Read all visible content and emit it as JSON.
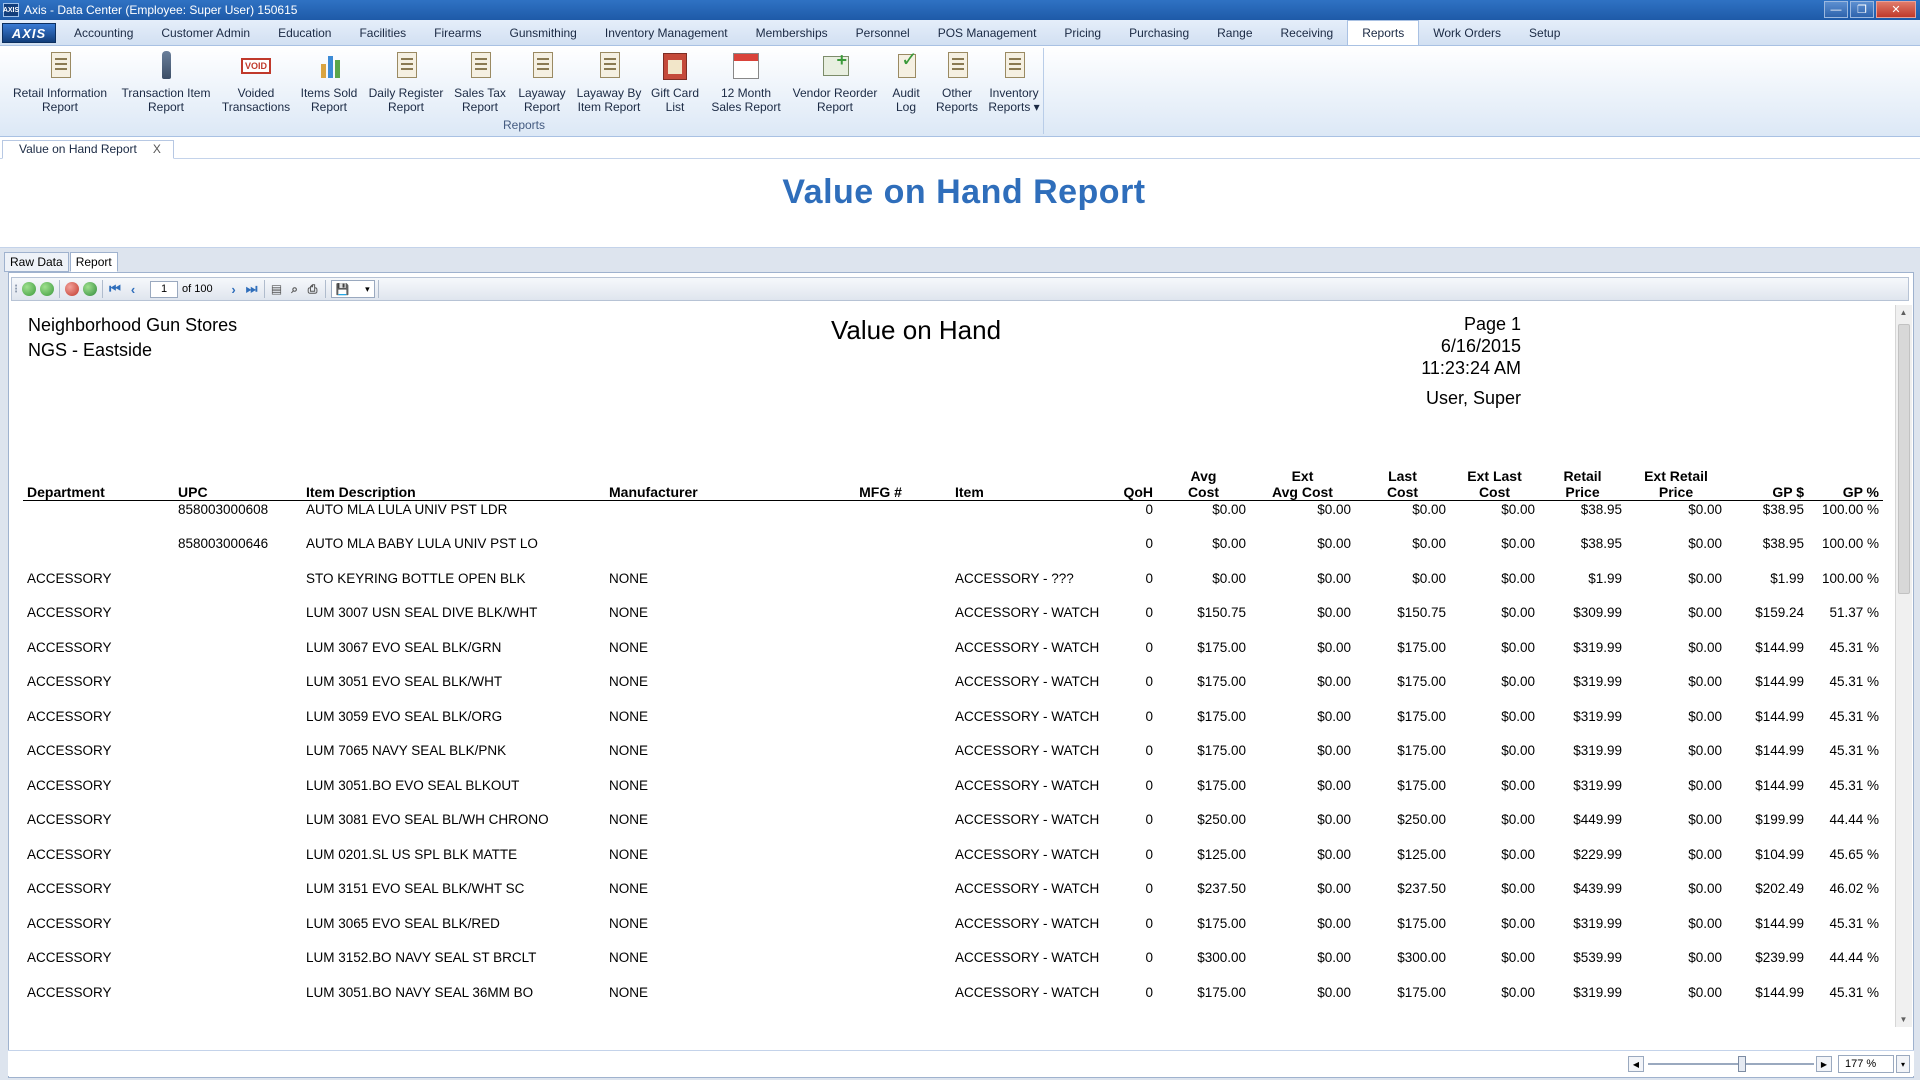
{
  "window": {
    "logo_label": "AXIS",
    "title": "Axis - Data Center  (Employee: Super User) 150615",
    "minimize": "—",
    "restore": "❐",
    "close": "✕"
  },
  "menu": {
    "logo": "AXIS",
    "tabs": [
      "Accounting",
      "Customer Admin",
      "Education",
      "Facilities",
      "Firearms",
      "Gunsmithing",
      "Inventory Management",
      "Memberships",
      "Personnel",
      "POS Management",
      "Pricing",
      "Purchasing",
      "Range",
      "Receiving",
      "Reports",
      "Work Orders",
      "Setup"
    ],
    "active": "Reports"
  },
  "ribbon": {
    "group_label": "Reports",
    "buttons": [
      {
        "line1": "Retail Information",
        "line2": "Report",
        "icon": "document-icon"
      },
      {
        "line1": "Transaction Item",
        "line2": "Report",
        "icon": "pen-icon"
      },
      {
        "line1": "Voided",
        "line2": "Transactions",
        "icon": "void-stamp-icon",
        "icon_text": "VOID"
      },
      {
        "line1": "Items Sold",
        "line2": "Report",
        "icon": "bar-chart-icon"
      },
      {
        "line1": "Daily Register",
        "line2": "Report",
        "icon": "document-icon"
      },
      {
        "line1": "Sales Tax",
        "line2": "Report",
        "icon": "document-icon"
      },
      {
        "line1": "Layaway",
        "line2": "Report",
        "icon": "document-icon"
      },
      {
        "line1": "Layaway By",
        "line2": "Item Report",
        "icon": "document-icon"
      },
      {
        "line1": "Gift Card",
        "line2": "List",
        "icon": "gift-card-icon"
      },
      {
        "line1": "12 Month",
        "line2": "Sales Report",
        "icon": "calendar-icon"
      },
      {
        "line1": "Vendor Reorder",
        "line2": "Report",
        "icon": "reorder-icon"
      },
      {
        "line1": "Audit",
        "line2": "Log",
        "icon": "checklist-icon"
      },
      {
        "line1": "Other",
        "line2": "Reports",
        "icon": "document-icon"
      },
      {
        "line1": "Inventory",
        "line2": "Reports ▾",
        "icon": "document-icon"
      }
    ]
  },
  "doc_tab": {
    "label": "Value on Hand Report",
    "close": "X"
  },
  "report_title": "Value on Hand Report",
  "subtabs": [
    "Raw Data",
    "Report"
  ],
  "toolbar": {
    "page": "1",
    "of": "of 100"
  },
  "report": {
    "company": "Neighborhood Gun Stores",
    "store": "NGS - Eastside",
    "name": "Value on Hand",
    "page": "Page 1",
    "date": "6/16/2015",
    "time": "11:23:24 AM",
    "user": "User, Super"
  },
  "columns": [
    {
      "l1": "",
      "l2": "Department"
    },
    {
      "l1": "",
      "l2": "UPC"
    },
    {
      "l1": "",
      "l2": "Item Description"
    },
    {
      "l1": "",
      "l2": "Manufacturer"
    },
    {
      "l1": "",
      "l2": "MFG #"
    },
    {
      "l1": "",
      "l2": "Item"
    },
    {
      "l1": "",
      "l2": "QoH"
    },
    {
      "l1": "Avg",
      "l2": "Cost"
    },
    {
      "l1": "Ext",
      "l2": "Avg Cost"
    },
    {
      "l1": "Last",
      "l2": "Cost"
    },
    {
      "l1": "Ext Last",
      "l2": "Cost"
    },
    {
      "l1": "Retail",
      "l2": "Price"
    },
    {
      "l1": "Ext Retail",
      "l2": "Price"
    },
    {
      "l1": "",
      "l2": "GP $"
    },
    {
      "l1": "",
      "l2": "GP %"
    }
  ],
  "rows": [
    [
      "",
      "858003000608",
      "AUTO MLA LULA UNIV PST LDR",
      "",
      "",
      "",
      "0",
      "$0.00",
      "$0.00",
      "$0.00",
      "$0.00",
      "$38.95",
      "$0.00",
      "$38.95",
      "100.00 %"
    ],
    [
      "",
      "858003000646",
      "AUTO MLA BABY LULA UNIV PST LO",
      "",
      "",
      "",
      "0",
      "$0.00",
      "$0.00",
      "$0.00",
      "$0.00",
      "$38.95",
      "$0.00",
      "$38.95",
      "100.00 %"
    ],
    [
      "ACCESSORY",
      "",
      "STO KEYRING BOTTLE OPEN BLK",
      "NONE",
      "",
      "ACCESSORY - ???",
      "0",
      "$0.00",
      "$0.00",
      "$0.00",
      "$0.00",
      "$1.99",
      "$0.00",
      "$1.99",
      "100.00 %"
    ],
    [
      "ACCESSORY",
      "",
      "LUM 3007 USN SEAL DIVE BLK/WHT",
      "NONE",
      "",
      "ACCESSORY - WATCH",
      "0",
      "$150.75",
      "$0.00",
      "$150.75",
      "$0.00",
      "$309.99",
      "$0.00",
      "$159.24",
      "51.37 %"
    ],
    [
      "ACCESSORY",
      "",
      "LUM 3067 EVO SEAL BLK/GRN",
      "NONE",
      "",
      "ACCESSORY - WATCH",
      "0",
      "$175.00",
      "$0.00",
      "$175.00",
      "$0.00",
      "$319.99",
      "$0.00",
      "$144.99",
      "45.31 %"
    ],
    [
      "ACCESSORY",
      "",
      "LUM 3051 EVO SEAL BLK/WHT",
      "NONE",
      "",
      "ACCESSORY - WATCH",
      "0",
      "$175.00",
      "$0.00",
      "$175.00",
      "$0.00",
      "$319.99",
      "$0.00",
      "$144.99",
      "45.31 %"
    ],
    [
      "ACCESSORY",
      "",
      "LUM 3059 EVO SEAL BLK/ORG",
      "NONE",
      "",
      "ACCESSORY - WATCH",
      "0",
      "$175.00",
      "$0.00",
      "$175.00",
      "$0.00",
      "$319.99",
      "$0.00",
      "$144.99",
      "45.31 %"
    ],
    [
      "ACCESSORY",
      "",
      "LUM 7065 NAVY SEAL BLK/PNK",
      "NONE",
      "",
      "ACCESSORY - WATCH",
      "0",
      "$175.00",
      "$0.00",
      "$175.00",
      "$0.00",
      "$319.99",
      "$0.00",
      "$144.99",
      "45.31 %"
    ],
    [
      "ACCESSORY",
      "",
      "LUM 3051.BO EVO SEAL BLKOUT",
      "NONE",
      "",
      "ACCESSORY - WATCH",
      "0",
      "$175.00",
      "$0.00",
      "$175.00",
      "$0.00",
      "$319.99",
      "$0.00",
      "$144.99",
      "45.31 %"
    ],
    [
      "ACCESSORY",
      "",
      "LUM 3081 EVO SEAL BL/WH CHRONO",
      "NONE",
      "",
      "ACCESSORY - WATCH",
      "0",
      "$250.00",
      "$0.00",
      "$250.00",
      "$0.00",
      "$449.99",
      "$0.00",
      "$199.99",
      "44.44 %"
    ],
    [
      "ACCESSORY",
      "",
      "LUM 0201.SL US SPL BLK MATTE",
      "NONE",
      "",
      "ACCESSORY - WATCH",
      "0",
      "$125.00",
      "$0.00",
      "$125.00",
      "$0.00",
      "$229.99",
      "$0.00",
      "$104.99",
      "45.65 %"
    ],
    [
      "ACCESSORY",
      "",
      "LUM 3151 EVO SEAL BLK/WHT SC",
      "NONE",
      "",
      "ACCESSORY - WATCH",
      "0",
      "$237.50",
      "$0.00",
      "$237.50",
      "$0.00",
      "$439.99",
      "$0.00",
      "$202.49",
      "46.02 %"
    ],
    [
      "ACCESSORY",
      "",
      "LUM 3065 EVO SEAL BLK/RED",
      "NONE",
      "",
      "ACCESSORY - WATCH",
      "0",
      "$175.00",
      "$0.00",
      "$175.00",
      "$0.00",
      "$319.99",
      "$0.00",
      "$144.99",
      "45.31 %"
    ],
    [
      "ACCESSORY",
      "",
      "LUM 3152.BO NAVY SEAL ST BRCLT",
      "NONE",
      "",
      "ACCESSORY - WATCH",
      "0",
      "$300.00",
      "$0.00",
      "$300.00",
      "$0.00",
      "$539.99",
      "$0.00",
      "$239.99",
      "44.44 %"
    ],
    [
      "ACCESSORY",
      "",
      "LUM 3051.BO NAVY SEAL 36MM BO",
      "NONE",
      "",
      "ACCESSORY - WATCH",
      "0",
      "$175.00",
      "$0.00",
      "$175.00",
      "$0.00",
      "$319.99",
      "$0.00",
      "$144.99",
      "45.31 %"
    ]
  ],
  "zoom": {
    "value": "177 %"
  },
  "colors": {
    "accent": "#2f6ebb",
    "titlebar": "#1e5aa8"
  }
}
